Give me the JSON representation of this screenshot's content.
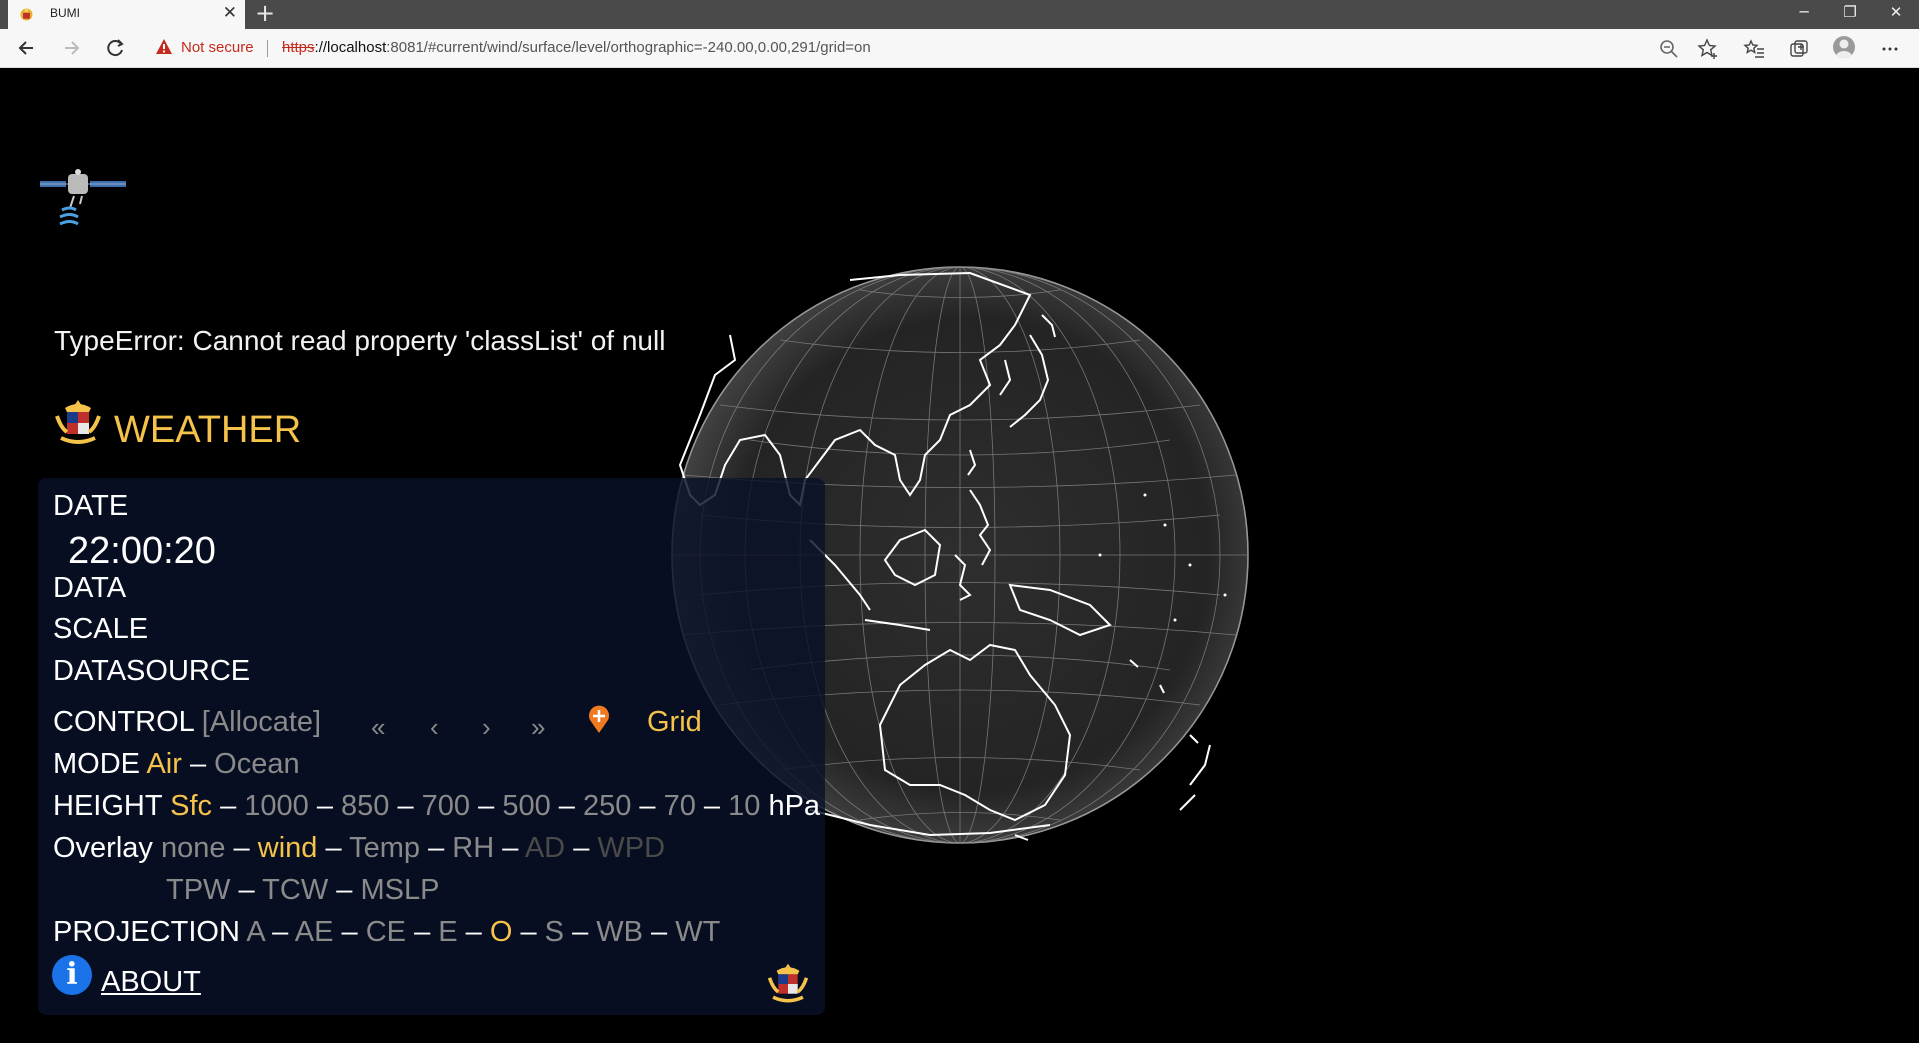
{
  "browser": {
    "tab_title": "BUMI",
    "tab_close": "✕",
    "new_tab": "+",
    "not_secure": "Not secure",
    "url_protocol": "https",
    "url_host": "://localhost",
    "url_rest": ":8081/#current/wind/surface/level/orthographic=-240.00,0.00,291/grid=on",
    "window_controls": [
      "─",
      "❐",
      "✕"
    ]
  },
  "page": {
    "error": "TypeError: Cannot read property 'classList' of null",
    "title": "WEATHER"
  },
  "panel": {
    "date_label": "DATE",
    "time": "22:00:20",
    "data_label": "DATA",
    "scale_label": "SCALE",
    "datasource_label": "DATASOURCE",
    "control_label": "CONTROL",
    "allocate": "[Allocate]",
    "nav_first": "«",
    "nav_prev": "‹",
    "nav_next": "›",
    "nav_last": "»",
    "grid": "Grid",
    "mode_label": "MODE",
    "mode_options": [
      {
        "label": "Air",
        "active": true
      },
      {
        "label": "Ocean",
        "active": false
      }
    ],
    "height_label": "HEIGHT",
    "height_options": [
      {
        "label": "Sfc",
        "active": true
      },
      {
        "label": "1000",
        "active": false
      },
      {
        "label": "850",
        "active": false
      },
      {
        "label": "700",
        "active": false
      },
      {
        "label": "500",
        "active": false
      },
      {
        "label": "250",
        "active": false
      },
      {
        "label": "70",
        "active": false
      },
      {
        "label": "10",
        "active": false
      }
    ],
    "height_unit": "hPa",
    "overlay_label": "Overlay",
    "overlay_row1": [
      {
        "label": "none",
        "state": "normal"
      },
      {
        "label": "wind",
        "state": "active"
      },
      {
        "label": "Temp",
        "state": "normal"
      },
      {
        "label": "RH",
        "state": "normal"
      },
      {
        "label": "AD",
        "state": "disabled"
      },
      {
        "label": "WPD",
        "state": "disabled"
      }
    ],
    "overlay_row2": [
      {
        "label": "TPW",
        "state": "normal"
      },
      {
        "label": "TCW",
        "state": "normal"
      },
      {
        "label": "MSLP",
        "state": "normal"
      }
    ],
    "projection_label": "PROJECTION",
    "projection_options": [
      {
        "label": "A",
        "active": false
      },
      {
        "label": "AE",
        "active": false
      },
      {
        "label": "CE",
        "active": false
      },
      {
        "label": "E",
        "active": false
      },
      {
        "label": "O",
        "active": true
      },
      {
        "label": "S",
        "active": false
      },
      {
        "label": "WB",
        "active": false
      },
      {
        "label": "WT",
        "active": false
      }
    ],
    "separator": "–",
    "about": "ABOUT",
    "info_glyph": "i"
  },
  "colors": {
    "accent": "#f5c24a",
    "inactive": "#8a8a8a",
    "disabled": "#4a4a4a",
    "info_blue": "#1a73e8"
  }
}
